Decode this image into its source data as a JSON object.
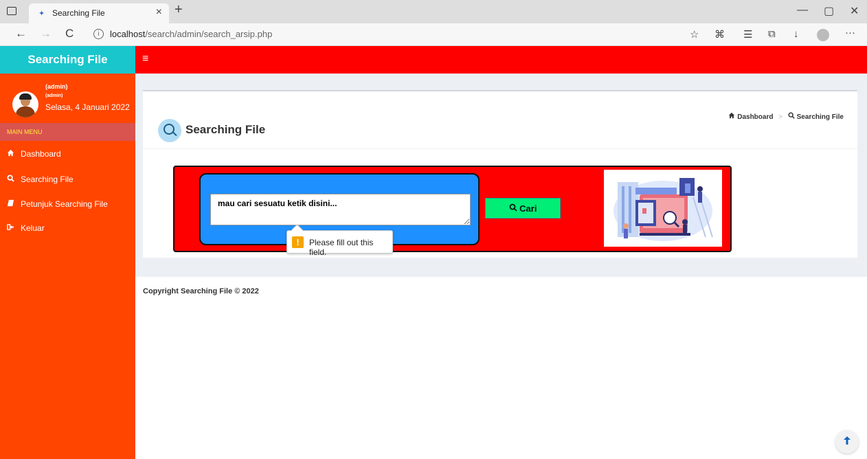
{
  "browser": {
    "tab_title": "Searching File",
    "tab_close": "×",
    "tab_new": "+",
    "url_host": "localhost",
    "url_path": "/search/admin/search_arsip.php",
    "back": "←",
    "forward": "→",
    "reload": "C",
    "minimize": "—",
    "restore": "▢",
    "close": "✕",
    "more": "···"
  },
  "sidebar": {
    "brand": "Searching File",
    "user_name": "(admin)",
    "user_role": "(admin)",
    "user_date": "Selasa, 4 Januari 2022",
    "menu_header": "MAIN MENU",
    "items": [
      {
        "label": "Dashboard",
        "icon": "home-icon"
      },
      {
        "label": "Searching File",
        "icon": "search-icon"
      },
      {
        "label": "Petunjuk Searching File",
        "icon": "book-icon"
      },
      {
        "label": "Keluar",
        "icon": "sign-out-icon"
      }
    ]
  },
  "topbar": {
    "menu_toggle": "≡"
  },
  "page": {
    "title": "Searching File",
    "breadcrumb": {
      "home": "Dashboard",
      "current": "Searching File"
    }
  },
  "search": {
    "placeholder": "mau cari sesuatu ketik disini...",
    "value": "",
    "button_label": "Cari"
  },
  "tooltip": {
    "message": "Please fill out this field."
  },
  "footer": {
    "copyright": "Copyright Searching File © 2022"
  },
  "colors": {
    "brand_bg": "#19c6cc",
    "sidebar_bg": "#ff4500",
    "topbar_bg": "#ff0000",
    "search_panel_bg": "#ff0000",
    "search_inner_bg": "#1e90ff",
    "button_bg": "#00ee76"
  }
}
